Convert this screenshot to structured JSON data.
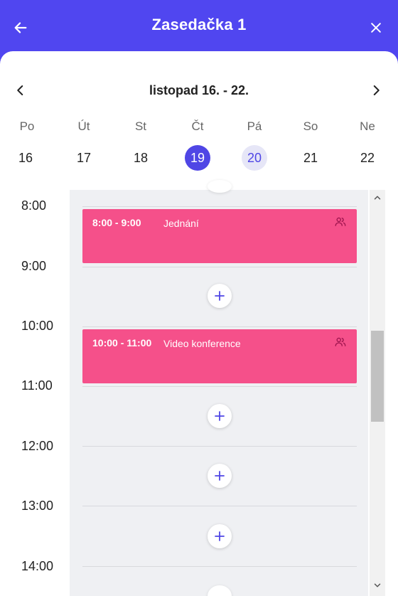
{
  "header": {
    "title": "Zasedačka 1",
    "back_icon": "arrow-left-icon",
    "close_icon": "close-icon"
  },
  "week": {
    "range_label": "listopad 16. - 22.",
    "prev_icon": "chevron-left-icon",
    "next_icon": "chevron-right-icon",
    "day_names": [
      "Po",
      "Út",
      "St",
      "Čt",
      "Pá",
      "So",
      "Ne"
    ],
    "day_numbers": [
      "16",
      "17",
      "18",
      "19",
      "20",
      "21",
      "22"
    ],
    "today_number": "19",
    "selected_number": "20"
  },
  "timeline": {
    "hours": [
      "8:00",
      "9:00",
      "10:00",
      "11:00",
      "12:00",
      "13:00",
      "14:00"
    ],
    "events": [
      {
        "time": "8:00 - 9:00",
        "title": "Jednání",
        "icon": "people-icon"
      },
      {
        "time": "10:00 - 11:00",
        "title": "Video konference",
        "icon": "people-icon"
      }
    ],
    "add_icon": "plus-icon"
  },
  "colors": {
    "primary": "#5046f0",
    "event": "#f5508a",
    "grid_bg": "#eff0f3"
  }
}
